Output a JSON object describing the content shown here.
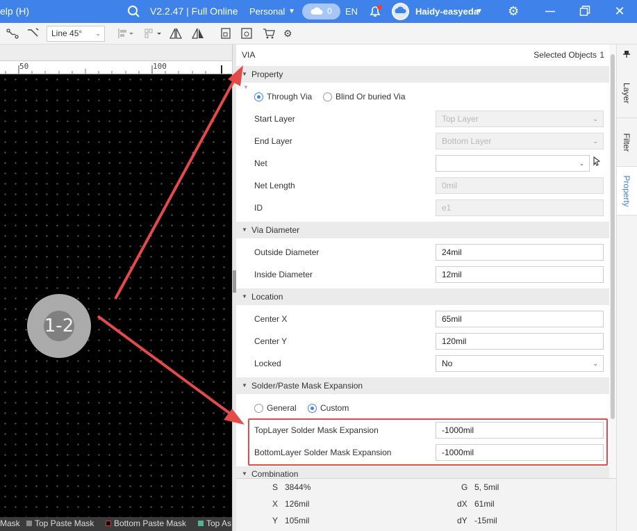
{
  "titlebar": {
    "menu_help": "elp (H)",
    "version": "V2.2.47 | Full Online",
    "plan": "Personal",
    "cloud_count": "0",
    "language": "EN",
    "username": "Haidy-easyeda"
  },
  "toolbar": {
    "line_mode": "Line 45°"
  },
  "ruler": {
    "label_50": "50",
    "label_100": "100"
  },
  "canvas": {
    "via_label": "1-2"
  },
  "layerbar": {
    "items": [
      "Mask",
      "Top Paste Mask",
      "Bottom Paste Mask",
      "Top As"
    ]
  },
  "panel": {
    "object_type": "VIA",
    "selected_label": "Selected Objects",
    "selected_count": "1",
    "sections": {
      "property": "Property",
      "via_diameter": "Via Diameter",
      "location": "Location",
      "mask_expansion": "Solder/Paste Mask Expansion",
      "combination": "Combination"
    },
    "via_type": {
      "through": "Through Via",
      "blind": "Blind Or buried Via"
    },
    "fields": {
      "start_layer": {
        "label": "Start Layer",
        "value": "Top Layer"
      },
      "end_layer": {
        "label": "End Layer",
        "value": "Bottom Layer"
      },
      "net": {
        "label": "Net",
        "value": ""
      },
      "net_length": {
        "label": "Net Length",
        "value": "0mil"
      },
      "id": {
        "label": "ID",
        "value": "e1"
      },
      "outside_diameter": {
        "label": "Outside Diameter",
        "value": "24mil"
      },
      "inside_diameter": {
        "label": "Inside Diameter",
        "value": "12mil"
      },
      "center_x": {
        "label": "Center X",
        "value": "65mil"
      },
      "center_y": {
        "label": "Center Y",
        "value": "120mil"
      },
      "locked": {
        "label": "Locked",
        "value": "No"
      },
      "top_mask": {
        "label": "TopLayer Solder Mask Expansion",
        "value": "-1000mil"
      },
      "bottom_mask": {
        "label": "BottomLayer Solder Mask Expansion",
        "value": "-1000mil"
      }
    },
    "mask_mode": {
      "general": "General",
      "custom": "Custom"
    },
    "stats": {
      "s_label": "S",
      "s_value": "3844%",
      "g_label": "G",
      "g_value": "5, 5mil",
      "x_label": "X",
      "x_value": "126mil",
      "dx_label": "dX",
      "dx_value": "61mil",
      "y_label": "Y",
      "y_value": "105mil",
      "dy_label": "dY",
      "dy_value": "-15mil"
    }
  },
  "side_tabs": {
    "layer": "Layer",
    "filter": "Filter",
    "property": "Property"
  },
  "colors": {
    "accent": "#3f82e9",
    "annotation": "#e54a4a",
    "pcb_background": "#000000",
    "via": "#ababab"
  }
}
